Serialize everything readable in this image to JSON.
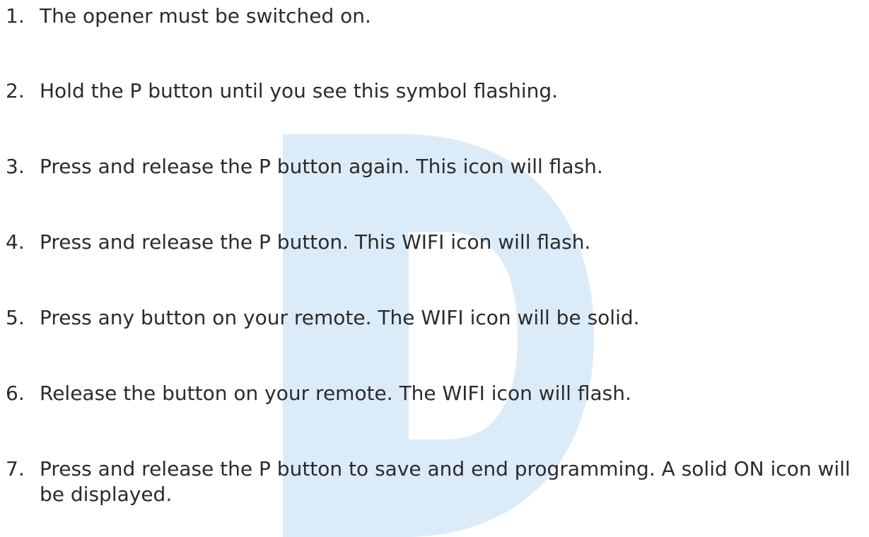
{
  "watermark": {
    "icon": "letter-d-watermark",
    "color": "#dcebf8"
  },
  "steps": [
    {
      "number": "1.",
      "text": "The opener must be switched on."
    },
    {
      "number": "2.",
      "text": "Hold the P button until you see this symbol flashing."
    },
    {
      "number": "3.",
      "text": "Press and release the P button again. This icon will flash."
    },
    {
      "number": "4.",
      "text": "Press and release the P button. This WIFI icon will flash."
    },
    {
      "number": "5.",
      "text": "Press any button on your remote. The WIFI icon will be solid."
    },
    {
      "number": "6.",
      "text": "Release the button on your remote. The WIFI icon will flash."
    },
    {
      "number": "7.",
      "text": "Press and release the P button to save and end programming. A solid ON icon will be displayed."
    }
  ]
}
